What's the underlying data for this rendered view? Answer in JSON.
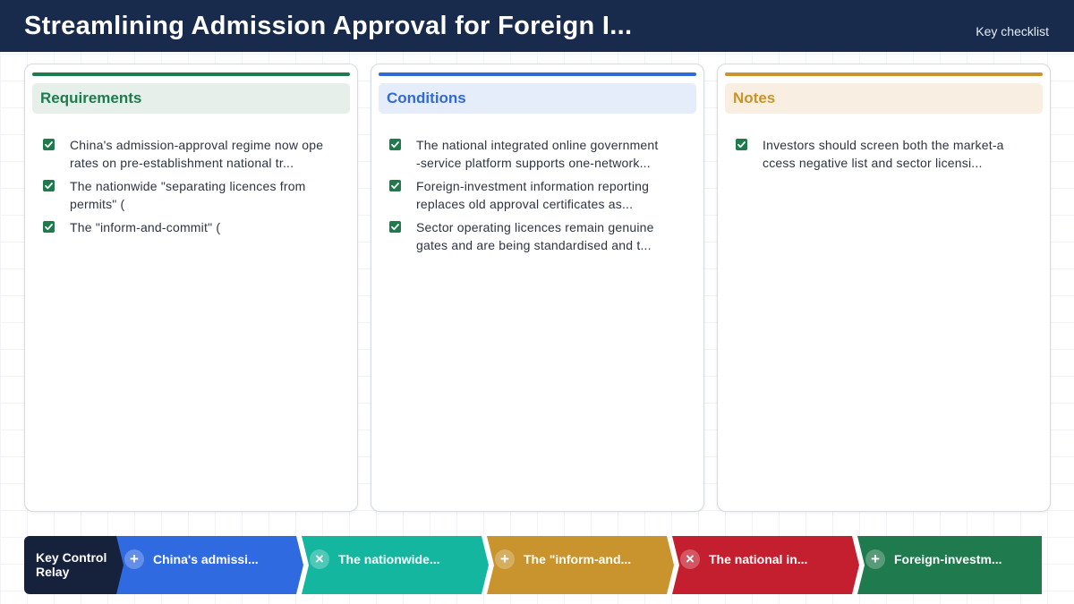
{
  "header": {
    "title": "Streamlining Admission Approval for Foreign I...",
    "subtitle": "Key checklist"
  },
  "columns": [
    {
      "title": "Requirements",
      "accent": "#1f7a4d",
      "head_bg": "#e6efe9",
      "items": [
        [
          "China's admission-approval regime now ope",
          "rates on pre-establishment national tr..."
        ],
        [
          "The nationwide \"separating licences from",
          "permits\" ("
        ],
        [
          "The \"inform-and-commit\" ("
        ]
      ]
    },
    {
      "title": "Conditions",
      "accent": "#2f6ad6",
      "head_bg": "#e5edfb",
      "items": [
        [
          "The national integrated online government",
          "-service platform supports one-network..."
        ],
        [
          "Foreign-investment information reporting",
          "replaces old approval certificates as..."
        ],
        [
          "Sector operating licences remain genuine",
          "gates and are being standardised and t..."
        ]
      ]
    },
    {
      "title": "Notes",
      "accent": "#c9932d",
      "head_bg": "#f8efe2",
      "items": [
        [
          "Investors should screen both the market-a",
          "ccess negative list and sector licensi..."
        ]
      ]
    }
  ],
  "relay": {
    "label": "Key Control Relay",
    "steps": [
      {
        "symbol": "+",
        "icon": "plus-icon",
        "text": "China's admissi...",
        "color": "#2f6ae0"
      },
      {
        "symbol": "×",
        "icon": "close-icon",
        "text": "The nationwide...",
        "color": "#14b6a0"
      },
      {
        "symbol": "+",
        "icon": "plus-icon",
        "text": "The \"inform-and...",
        "color": "#c9932d"
      },
      {
        "symbol": "×",
        "icon": "close-icon",
        "text": "The national in...",
        "color": "#c41f2e"
      },
      {
        "symbol": "+",
        "icon": "plus-icon",
        "text": "Foreign-investm...",
        "color": "#1f7a4d"
      }
    ]
  }
}
